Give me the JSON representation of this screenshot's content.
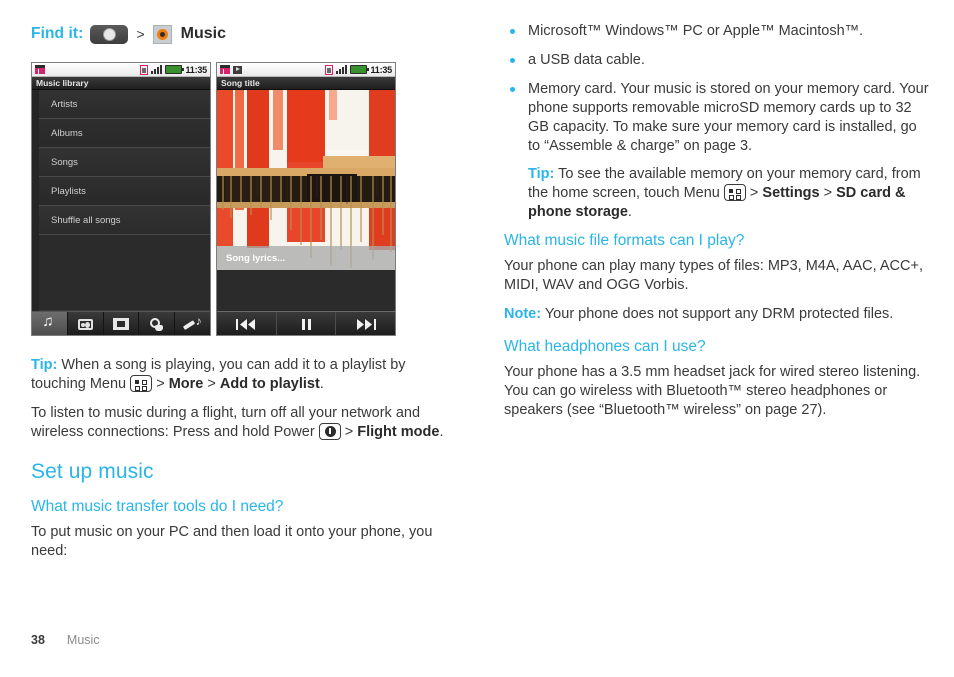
{
  "findit": {
    "label": "Find it:",
    "separator": ">",
    "home_icon": "home-app-drawer-icon",
    "app_icon": "music-app-icon",
    "title": "Music"
  },
  "phones": {
    "library": {
      "status": {
        "time": "11:35",
        "icons": [
          "sim-card-icon",
          "signal-bars-icon",
          "battery-icon"
        ]
      },
      "title": "Music library",
      "items": [
        "Artists",
        "Albums",
        "Songs",
        "Playlists",
        "Shuffle all songs"
      ],
      "tabs": [
        {
          "name": "music-tab",
          "icon": "music-note-icon",
          "active": true
        },
        {
          "name": "radio-tab",
          "icon": "radio-icon",
          "active": false
        },
        {
          "name": "videos-tab",
          "icon": "film-strip-icon",
          "active": false
        },
        {
          "name": "online-tab",
          "icon": "globe-video-icon",
          "active": false
        },
        {
          "name": "recorder-tab",
          "icon": "microphone-note-icon",
          "active": false
        }
      ]
    },
    "player": {
      "status": {
        "time": "11:35",
        "icons": [
          "sim-card-icon",
          "playing-icon",
          "signal-bars-icon",
          "battery-icon"
        ]
      },
      "title": "Song title",
      "lyrics_label": "Song lyrics...",
      "controls": [
        {
          "name": "previous-button",
          "glyph": "|◀◀"
        },
        {
          "name": "pause-button",
          "glyph": "||"
        },
        {
          "name": "next-button",
          "glyph": "▶▶|"
        }
      ]
    }
  },
  "left_column": {
    "tip_playlist": {
      "label": "Tip:",
      "text_1": "When a song is playing, you can add it to a playlist by touching Menu",
      "menu_icon": "menu-key-icon",
      "sep": ">",
      "bold_1": "More",
      "bold_2": "Add to playlist",
      "period": "."
    },
    "flight_paragraph": {
      "text_1": "To listen to music during a flight, turn off all your network and wireless connections: Press and hold Power",
      "power_icon": "power-key-icon",
      "sep": ">",
      "bold_1": "Flight mode",
      "period": "."
    },
    "section_heading": "Set up music",
    "subsection_heading": "What music transfer tools do I need?",
    "intro_paragraph": "To put music on your PC and then load it onto your phone, you need:"
  },
  "right_column": {
    "bullets": [
      "Microsoft™ Windows™ PC or Apple™ Macintosh™.",
      "a USB data cable.",
      "Memory card. Your music is stored on your memory card. Your phone supports removable microSD memory cards up to 32 GB capacity. To make sure your memory card is installed, go to “Assemble & charge” on page 3."
    ],
    "memory_tip": {
      "label": "Tip:",
      "text_1": "To see the available memory on your memory card, from the home screen, touch Menu",
      "menu_icon": "menu-key-icon",
      "sep": ">",
      "bold_1": "Settings",
      "bold_2": "SD card & phone storage",
      "period": "."
    },
    "formats": {
      "heading": "What music file formats can I play?",
      "paragraph": "Your phone can play many types of files: MP3, M4A, AAC, ACC+, MIDI, WAV and OGG Vorbis.",
      "note_label": "Note:",
      "note_text": "Your phone does not support any DRM protected files."
    },
    "headphones": {
      "heading": "What headphones can I use?",
      "paragraph": "Your phone has a 3.5 mm headset jack for wired stereo listening. You can go wireless with Bluetooth™ stereo headphones or speakers (see “Bluetooth™ wireless” on page 27)."
    }
  },
  "footer": {
    "page_number": "38",
    "section": "Music"
  },
  "colors": {
    "accent_blue": "#29b5e8",
    "body_text": "#3a3a3a",
    "footer_gray": "#8d8d8d"
  }
}
